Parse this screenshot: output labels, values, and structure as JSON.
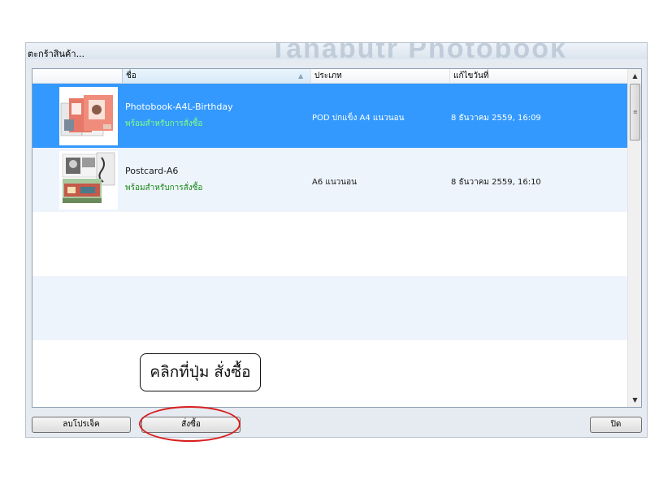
{
  "window": {
    "title": "ตะกร้าสินค้า...",
    "watermark": "Tanabutr Photobook"
  },
  "table": {
    "headers": {
      "name": "ชื่อ",
      "type": "ประเภท",
      "date": "แก้ไขวันที่"
    },
    "rows": [
      {
        "name": "Photobook-A4L-Birthday",
        "status": "พร้อมสำหรับการสั่งซื้อ",
        "type": "POD ปกแข็ง A4 แนวนอน",
        "date": "8 ธันวาคม 2559, 16:09",
        "selected": true,
        "thumb_icon": "photobook-thumbnail"
      },
      {
        "name": "Postcard-A6",
        "status": "พร้อมสำหรับการสั่งซื้อ",
        "type": "A6 แนวนอน",
        "date": "8 ธันวาคม 2559, 16:10",
        "selected": false,
        "thumb_icon": "postcard-thumbnail"
      }
    ]
  },
  "buttons": {
    "delete": "ลบโปรเจ็ค",
    "order": "สั่งซื้อ",
    "close": "ปิด"
  },
  "annotation": {
    "callout": "คลิกที่ปุ่ม สั่งซื้อ",
    "highlight_color": "#d81e1e"
  },
  "colors": {
    "selection": "#3399ff",
    "status_green": "#1a8a1a",
    "alt_row": "#eef4fc"
  }
}
